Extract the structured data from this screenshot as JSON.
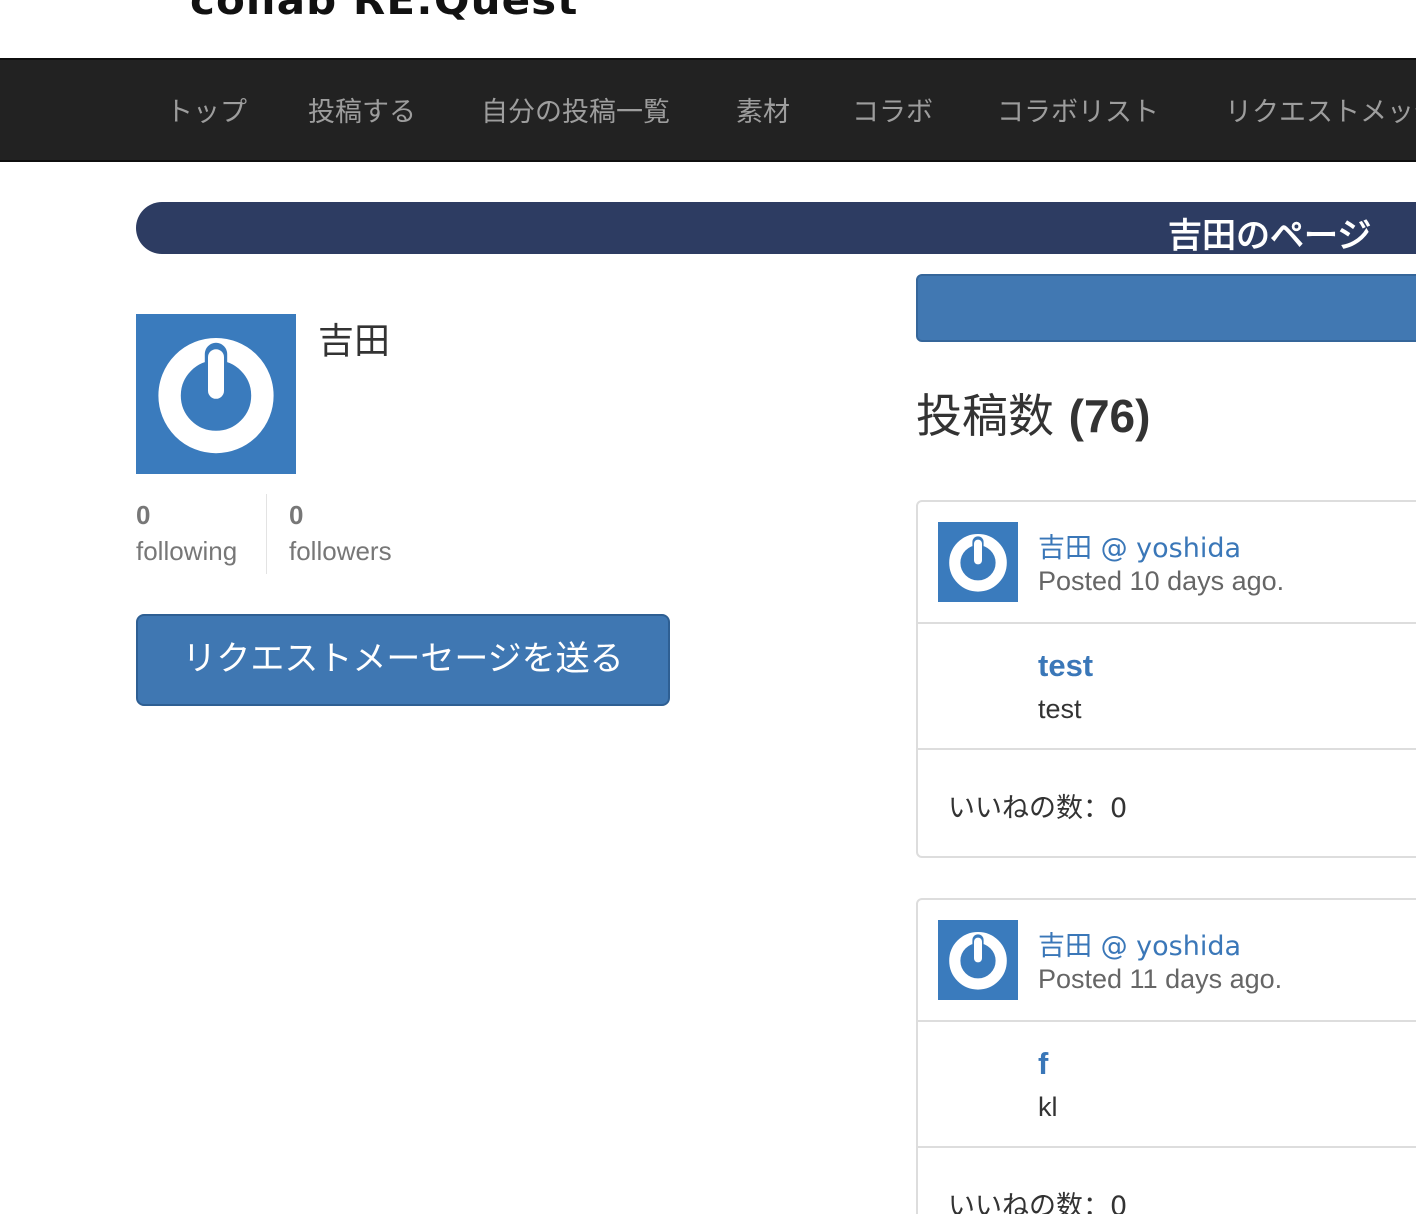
{
  "header": {
    "logo": "collab RE:Quest"
  },
  "nav": {
    "items": [
      "トップ",
      "投稿する",
      "自分の投稿一覧",
      "素材",
      "コラボ",
      "コラボリスト",
      "リクエストメッセージ"
    ]
  },
  "page_title": "吉田のページ",
  "profile": {
    "name": "吉田",
    "avatar_icon": "power-logo-icon",
    "following_count": "0",
    "following_label": "following",
    "followers_count": "0",
    "followers_label": "followers",
    "request_button": "リクエストメーセージを送る"
  },
  "posts": {
    "heading": "投稿数",
    "count": "(76)",
    "items": [
      {
        "author": "吉田 @ yoshida",
        "posted": "Posted 10 days ago.",
        "title": "test",
        "text": "test",
        "likes": "いいねの数：0"
      },
      {
        "author": "吉田 @ yoshida",
        "posted": "Posted 11 days ago.",
        "title": "f",
        "text": "kl",
        "likes": "いいねの数：0"
      }
    ]
  },
  "colors": {
    "nav_bg": "#222222",
    "banner_bg": "#2d3c62",
    "accent_blue": "#3f77b2",
    "link_blue": "#3a77b8"
  }
}
